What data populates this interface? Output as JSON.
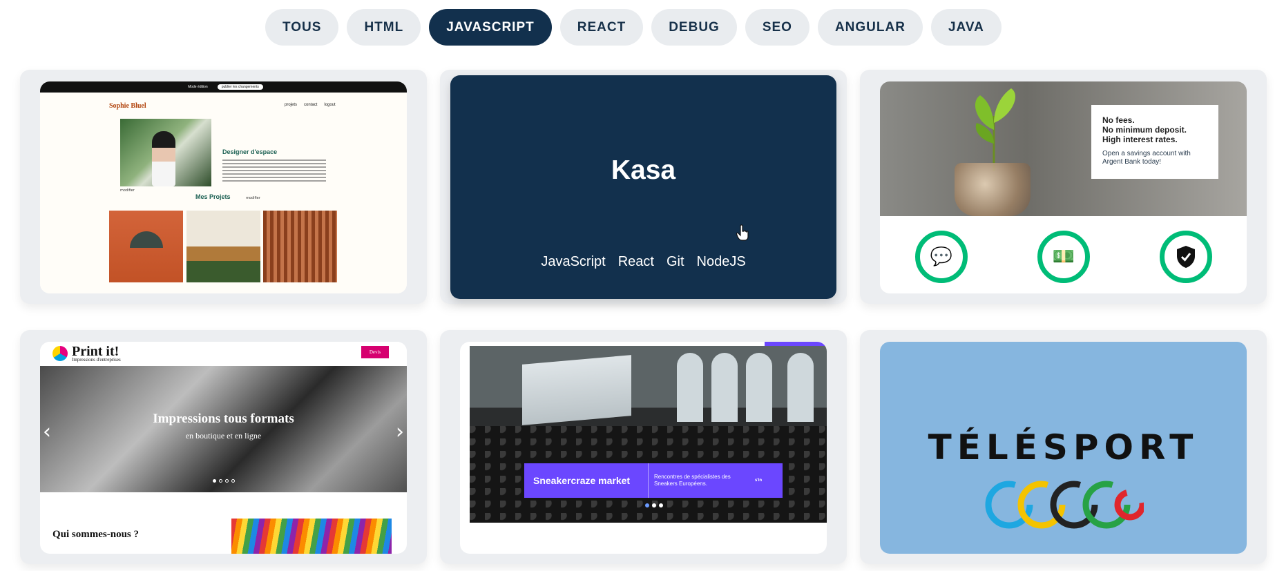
{
  "filters": [
    {
      "label": "TOUS",
      "active": false
    },
    {
      "label": "HTML",
      "active": false
    },
    {
      "label": "JAVASCRIPT",
      "active": true
    },
    {
      "label": "REACT",
      "active": false
    },
    {
      "label": "DEBUG",
      "active": false
    },
    {
      "label": "SEO",
      "active": false
    },
    {
      "label": "ANGULAR",
      "active": false
    },
    {
      "label": "JAVA",
      "active": false
    }
  ],
  "projects": {
    "sophie": {
      "top_left": "Mode édition",
      "top_btn": "publier les changements",
      "logo": "Sophie Bluel",
      "nav": [
        "projets",
        "contact",
        "logout"
      ],
      "heading": "Designer d'espace",
      "modifier": "modifier",
      "projects_title": "Mes Projets"
    },
    "kasa": {
      "title": "Kasa",
      "tags": [
        "JavaScript",
        "React",
        "Git",
        "NodeJS"
      ]
    },
    "argent": {
      "line1": "No fees.",
      "line2": "No minimum deposit.",
      "line3": "High interest rates.",
      "text": "Open a savings account with Argent Bank today!"
    },
    "printit": {
      "name": "Print it!",
      "subtitle": "Impressions d'entreprises",
      "devis": "Devis",
      "banner_title": "Impressions tous formats",
      "banner_sub": "en boutique et en ligne",
      "section": "Qui sommes-nous ?"
    },
    "sneaker": {
      "title": "Sneakercraze market",
      "desc": "Rencontres de spécialistes des Sneakers Européens.",
      "cta": "s'in"
    },
    "telesport": {
      "title": "TÉLÉSPORT"
    }
  },
  "colors": {
    "navy": "#12304d",
    "pill": "#e9ecef",
    "argent_green": "#00bc77",
    "sneaker_purple": "#6b47ff",
    "print_pink": "#d6006f"
  }
}
